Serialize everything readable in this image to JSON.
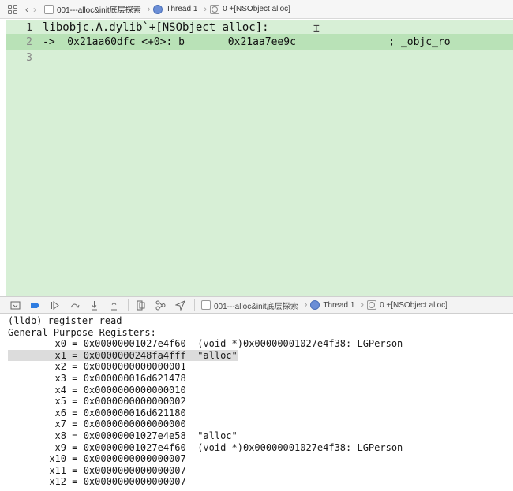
{
  "jumpbar": {
    "breadcrumb_file": "001---alloc&init底层探索",
    "breadcrumb_thread": "Thread 1",
    "breadcrumb_frame": "0 +[NSObject alloc]"
  },
  "editor": {
    "lines": [
      {
        "num": "1",
        "text": "libobjc.A.dylib`+[NSObject alloc]:"
      },
      {
        "num": "2",
        "text": "->  0x21aa60dfc <+0>: b       0x21aa7ee9c               ; _objc_ro"
      },
      {
        "num": "3",
        "text": ""
      }
    ]
  },
  "debugbar": {
    "breadcrumb_file": "001---alloc&init底层探索",
    "breadcrumb_thread": "Thread 1",
    "breadcrumb_frame": "0 +[NSObject alloc]"
  },
  "console": {
    "prompt_line": "(lldb) register read",
    "header": "General Purpose Registers:",
    "registers": [
      {
        "name": "x0",
        "value": "0x00000001027e4f60",
        "note": "(void *)0x00000001027e4f38: LGPerson"
      },
      {
        "name": "x1",
        "value": "0x0000000248fa4fff",
        "note": "\"alloc\""
      },
      {
        "name": "x2",
        "value": "0x0000000000000001",
        "note": ""
      },
      {
        "name": "x3",
        "value": "0x000000016d621478",
        "note": ""
      },
      {
        "name": "x4",
        "value": "0x0000000000000010",
        "note": ""
      },
      {
        "name": "x5",
        "value": "0x0000000000000002",
        "note": ""
      },
      {
        "name": "x6",
        "value": "0x000000016d621180",
        "note": ""
      },
      {
        "name": "x7",
        "value": "0x0000000000000000",
        "note": ""
      },
      {
        "name": "x8",
        "value": "0x00000001027e4e58",
        "note": "\"alloc\""
      },
      {
        "name": "x9",
        "value": "0x00000001027e4f60",
        "note": "(void *)0x00000001027e4f38: LGPerson"
      },
      {
        "name": "x10",
        "value": "0x0000000000000007",
        "note": ""
      },
      {
        "name": "x11",
        "value": "0x0000000000000007",
        "note": ""
      },
      {
        "name": "x12",
        "value": "0x0000000000000007",
        "note": ""
      }
    ]
  }
}
